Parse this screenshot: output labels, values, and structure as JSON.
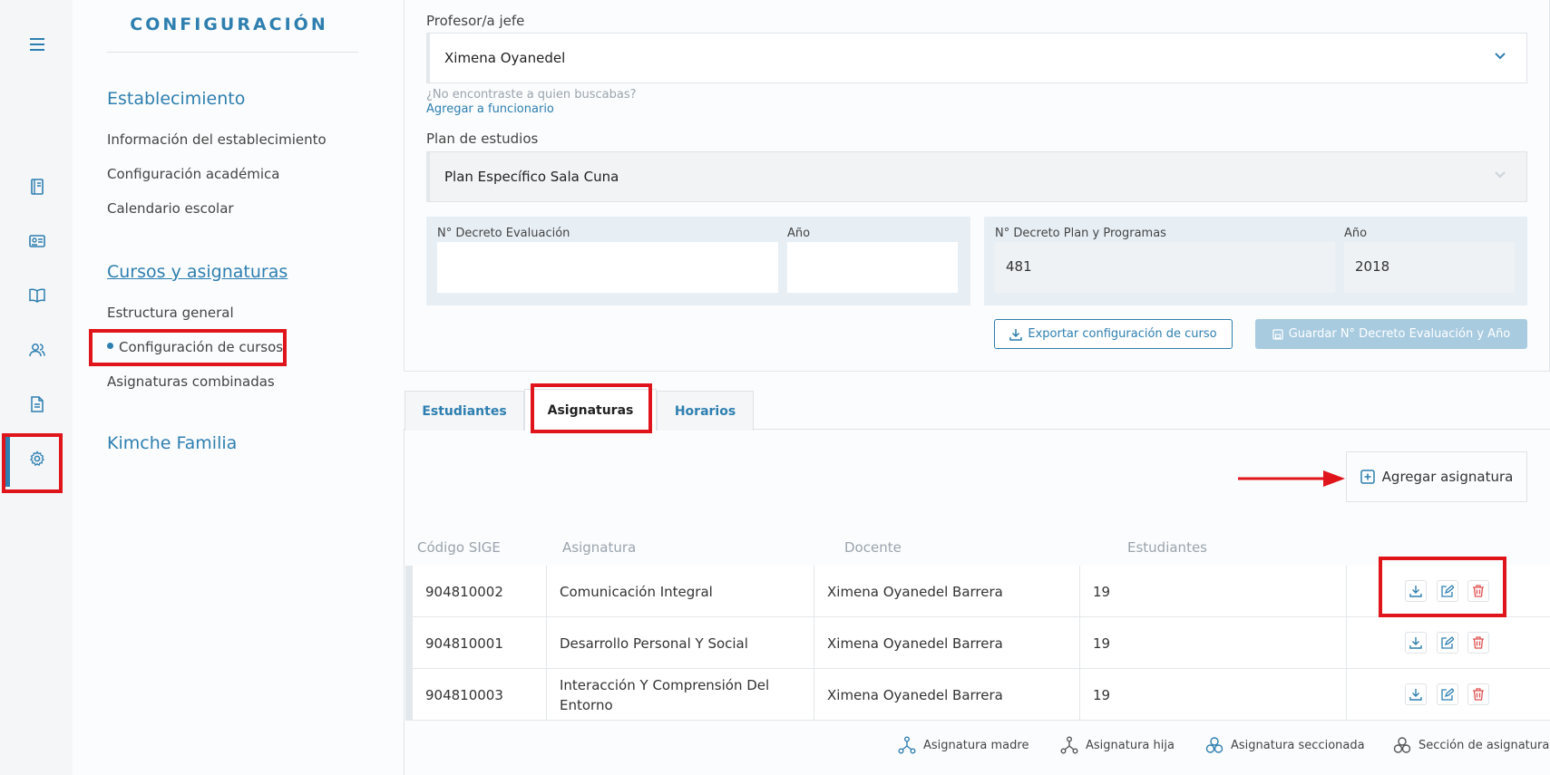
{
  "rail": {
    "icons": [
      "menu-icon",
      "book-icon",
      "id-card-icon",
      "open-book-icon",
      "users-icon",
      "document-icon",
      "gear-icon"
    ]
  },
  "sidebar": {
    "title": "CONFIGURACIÓN",
    "sections": [
      {
        "title": "Establecimiento",
        "items": [
          "Información del establecimiento",
          "Configuración académica",
          "Calendario escolar"
        ]
      },
      {
        "title": "Cursos y asignaturas",
        "items": [
          "Estructura general",
          "Configuración de cursos",
          "Asignaturas combinadas"
        ],
        "active_item": "Configuración de cursos"
      },
      {
        "title": "Kimche Familia",
        "items": []
      }
    ]
  },
  "form": {
    "teacher_label": "Profesor/a jefe",
    "teacher_value": "Ximena Oyanedel",
    "not_found_hint": "¿No encontraste a quien buscabas?",
    "add_staff_link": "Agregar a funcionario",
    "plan_label": "Plan de estudios",
    "plan_value": "Plan Específico Sala Cuna",
    "decree_eval_label": "N° Decreto Evaluación",
    "decree_eval_value": "",
    "year_eval_label": "Año",
    "year_eval_value": "",
    "decree_plan_label": "N° Decreto Plan y Programas",
    "decree_plan_value": "481",
    "year_plan_label": "Año",
    "year_plan_value": "2018",
    "export_button": "Exportar configuración de curso",
    "save_button": "Guardar N° Decreto Evaluación y Año"
  },
  "tabs": [
    {
      "label": "Estudiantes",
      "active": false
    },
    {
      "label": "Asignaturas",
      "active": true
    },
    {
      "label": "Horarios",
      "active": false
    }
  ],
  "subjects": {
    "add_button": "Agregar asignatura",
    "columns": [
      "Código SIGE",
      "Asignatura",
      "Docente",
      "Estudiantes"
    ],
    "rows": [
      {
        "code": "904810002",
        "subject": "Comunicación Integral",
        "teacher": "Ximena Oyanedel Barrera",
        "students": "19"
      },
      {
        "code": "904810001",
        "subject": "Desarrollo Personal Y Social",
        "teacher": "Ximena Oyanedel Barrera",
        "students": "19"
      },
      {
        "code": "904810003",
        "subject": "Interacción Y Comprensión Del Entorno",
        "teacher": "Ximena Oyanedel Barrera",
        "students": "19"
      }
    ],
    "legend": [
      "Asignatura madre",
      "Asignatura hija",
      "Asignatura seccionada",
      "Sección de asignatura"
    ]
  },
  "colors": {
    "accent": "#2e7fb0",
    "annotation_red": "#e0151b",
    "delete_red": "#e05252"
  }
}
